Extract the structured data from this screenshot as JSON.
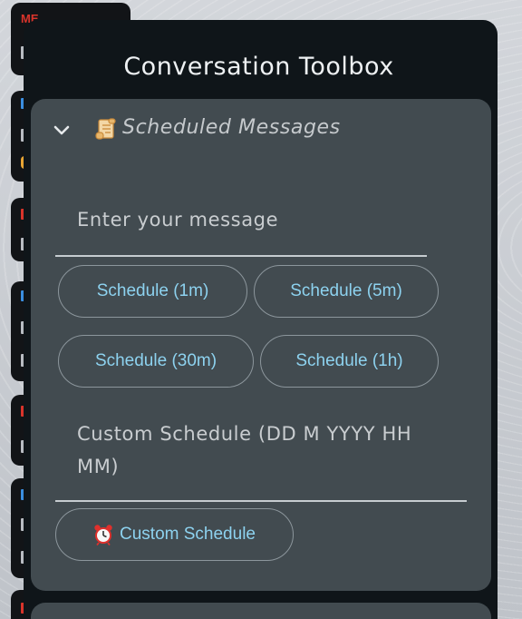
{
  "panel": {
    "title": "Conversation Toolbox"
  },
  "scheduled_messages": {
    "header_label": "Scheduled Messages",
    "header_icon": "scroll-emoji-icon",
    "toggle_icon": "chevron-down-icon",
    "message_input": {
      "placeholder": "Enter your message",
      "value": ""
    },
    "buttons": [
      {
        "label": "Schedule (1m)"
      },
      {
        "label": "Schedule (5m)"
      },
      {
        "label": "Schedule (30m)"
      },
      {
        "label": "Schedule (1h)"
      }
    ],
    "custom_input": {
      "placeholder_line1": "Custom Schedule (DD M YYYY HH",
      "placeholder_line2": "MM)",
      "value": ""
    },
    "custom_button": {
      "label": "Custom Schedule",
      "icon": "alarm-clock-icon"
    }
  },
  "background_chat": {
    "tag": "ME"
  },
  "colors": {
    "panel_bg": "#0f1519",
    "card_bg": "#424b50",
    "button_text": "#8dd2ef",
    "title_text": "#eef1f3"
  }
}
